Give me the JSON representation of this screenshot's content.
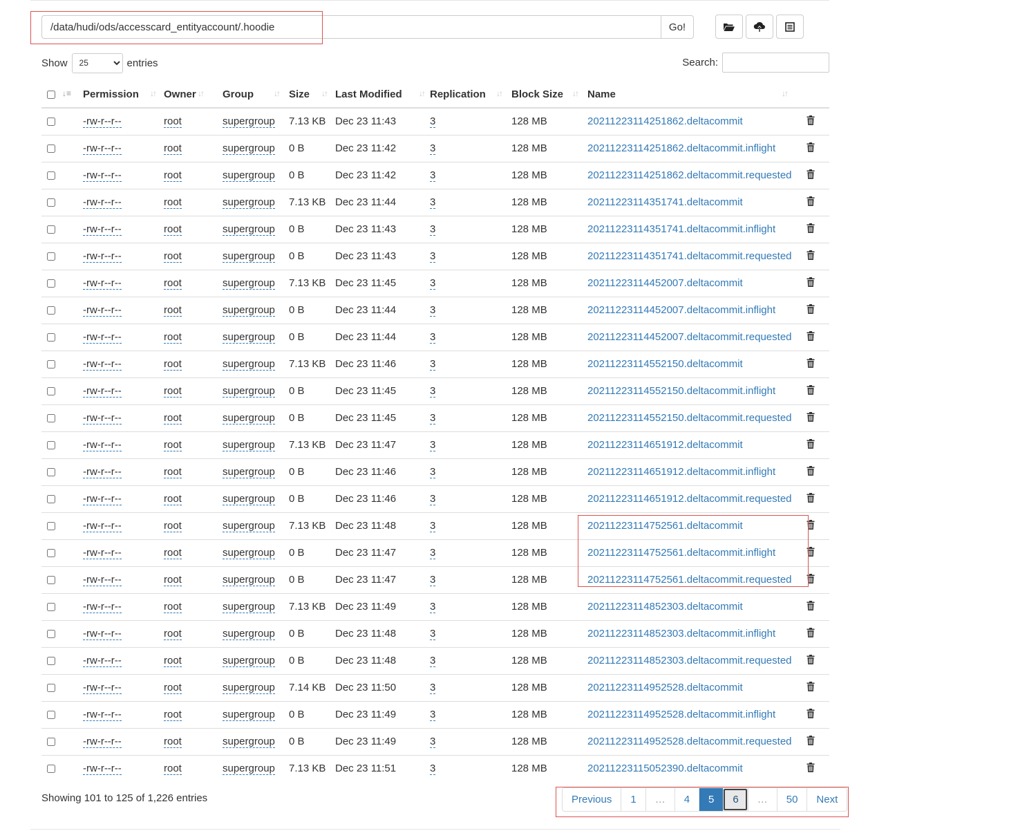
{
  "path_bar": {
    "value": "/data/hudi/ods/accesscard_entityaccount/.hoodie",
    "go_label": "Go!"
  },
  "toolbar": {
    "icons": [
      "folder-open-icon",
      "cloud-upload-icon",
      "list-icon"
    ]
  },
  "length": {
    "show_label": "Show",
    "selected": "25",
    "options": [
      "25"
    ],
    "entries_label": "entries"
  },
  "search": {
    "label": "Search:",
    "value": ""
  },
  "table": {
    "columns": [
      "Permission",
      "Owner",
      "Group",
      "Size",
      "Last Modified",
      "Replication",
      "Block Size",
      "Name"
    ],
    "rows": [
      [
        "-rw-r--r--",
        "root",
        "supergroup",
        "7.13 KB",
        "Dec 23 11:43",
        "3",
        "128 MB",
        "20211223114251862.deltacommit"
      ],
      [
        "-rw-r--r--",
        "root",
        "supergroup",
        "0 B",
        "Dec 23 11:42",
        "3",
        "128 MB",
        "20211223114251862.deltacommit.inflight"
      ],
      [
        "-rw-r--r--",
        "root",
        "supergroup",
        "0 B",
        "Dec 23 11:42",
        "3",
        "128 MB",
        "20211223114251862.deltacommit.requested"
      ],
      [
        "-rw-r--r--",
        "root",
        "supergroup",
        "7.13 KB",
        "Dec 23 11:44",
        "3",
        "128 MB",
        "20211223114351741.deltacommit"
      ],
      [
        "-rw-r--r--",
        "root",
        "supergroup",
        "0 B",
        "Dec 23 11:43",
        "3",
        "128 MB",
        "20211223114351741.deltacommit.inflight"
      ],
      [
        "-rw-r--r--",
        "root",
        "supergroup",
        "0 B",
        "Dec 23 11:43",
        "3",
        "128 MB",
        "20211223114351741.deltacommit.requested"
      ],
      [
        "-rw-r--r--",
        "root",
        "supergroup",
        "7.13 KB",
        "Dec 23 11:45",
        "3",
        "128 MB",
        "20211223114452007.deltacommit"
      ],
      [
        "-rw-r--r--",
        "root",
        "supergroup",
        "0 B",
        "Dec 23 11:44",
        "3",
        "128 MB",
        "20211223114452007.deltacommit.inflight"
      ],
      [
        "-rw-r--r--",
        "root",
        "supergroup",
        "0 B",
        "Dec 23 11:44",
        "3",
        "128 MB",
        "20211223114452007.deltacommit.requested"
      ],
      [
        "-rw-r--r--",
        "root",
        "supergroup",
        "7.13 KB",
        "Dec 23 11:46",
        "3",
        "128 MB",
        "20211223114552150.deltacommit"
      ],
      [
        "-rw-r--r--",
        "root",
        "supergroup",
        "0 B",
        "Dec 23 11:45",
        "3",
        "128 MB",
        "20211223114552150.deltacommit.inflight"
      ],
      [
        "-rw-r--r--",
        "root",
        "supergroup",
        "0 B",
        "Dec 23 11:45",
        "3",
        "128 MB",
        "20211223114552150.deltacommit.requested"
      ],
      [
        "-rw-r--r--",
        "root",
        "supergroup",
        "7.13 KB",
        "Dec 23 11:47",
        "3",
        "128 MB",
        "20211223114651912.deltacommit"
      ],
      [
        "-rw-r--r--",
        "root",
        "supergroup",
        "0 B",
        "Dec 23 11:46",
        "3",
        "128 MB",
        "20211223114651912.deltacommit.inflight"
      ],
      [
        "-rw-r--r--",
        "root",
        "supergroup",
        "0 B",
        "Dec 23 11:46",
        "3",
        "128 MB",
        "20211223114651912.deltacommit.requested"
      ],
      [
        "-rw-r--r--",
        "root",
        "supergroup",
        "7.13 KB",
        "Dec 23 11:48",
        "3",
        "128 MB",
        "20211223114752561.deltacommit"
      ],
      [
        "-rw-r--r--",
        "root",
        "supergroup",
        "0 B",
        "Dec 23 11:47",
        "3",
        "128 MB",
        "20211223114752561.deltacommit.inflight"
      ],
      [
        "-rw-r--r--",
        "root",
        "supergroup",
        "0 B",
        "Dec 23 11:47",
        "3",
        "128 MB",
        "20211223114752561.deltacommit.requested"
      ],
      [
        "-rw-r--r--",
        "root",
        "supergroup",
        "7.13 KB",
        "Dec 23 11:49",
        "3",
        "128 MB",
        "20211223114852303.deltacommit"
      ],
      [
        "-rw-r--r--",
        "root",
        "supergroup",
        "0 B",
        "Dec 23 11:48",
        "3",
        "128 MB",
        "20211223114852303.deltacommit.inflight"
      ],
      [
        "-rw-r--r--",
        "root",
        "supergroup",
        "0 B",
        "Dec 23 11:48",
        "3",
        "128 MB",
        "20211223114852303.deltacommit.requested"
      ],
      [
        "-rw-r--r--",
        "root",
        "supergroup",
        "7.14 KB",
        "Dec 23 11:50",
        "3",
        "128 MB",
        "20211223114952528.deltacommit"
      ],
      [
        "-rw-r--r--",
        "root",
        "supergroup",
        "0 B",
        "Dec 23 11:49",
        "3",
        "128 MB",
        "20211223114952528.deltacommit.inflight"
      ],
      [
        "-rw-r--r--",
        "root",
        "supergroup",
        "0 B",
        "Dec 23 11:49",
        "3",
        "128 MB",
        "20211223114952528.deltacommit.requested"
      ],
      [
        "-rw-r--r--",
        "root",
        "supergroup",
        "7.13 KB",
        "Dec 23 11:51",
        "3",
        "128 MB",
        "20211223115052390.deltacommit"
      ]
    ]
  },
  "info": "Showing 101 to 125 of 1,226 entries",
  "pagination": {
    "items": [
      {
        "label": "Previous",
        "state": ""
      },
      {
        "label": "1",
        "state": ""
      },
      {
        "label": "…",
        "state": "ellipsis"
      },
      {
        "label": "4",
        "state": ""
      },
      {
        "label": "5",
        "state": "active"
      },
      {
        "label": "6",
        "state": "focused"
      },
      {
        "label": "…",
        "state": "ellipsis"
      },
      {
        "label": "50",
        "state": ""
      },
      {
        "label": "Next",
        "state": ""
      }
    ]
  },
  "colors": {
    "link": "#337ab7",
    "annotation": "#d9534f",
    "active_page": "#337ab7"
  }
}
